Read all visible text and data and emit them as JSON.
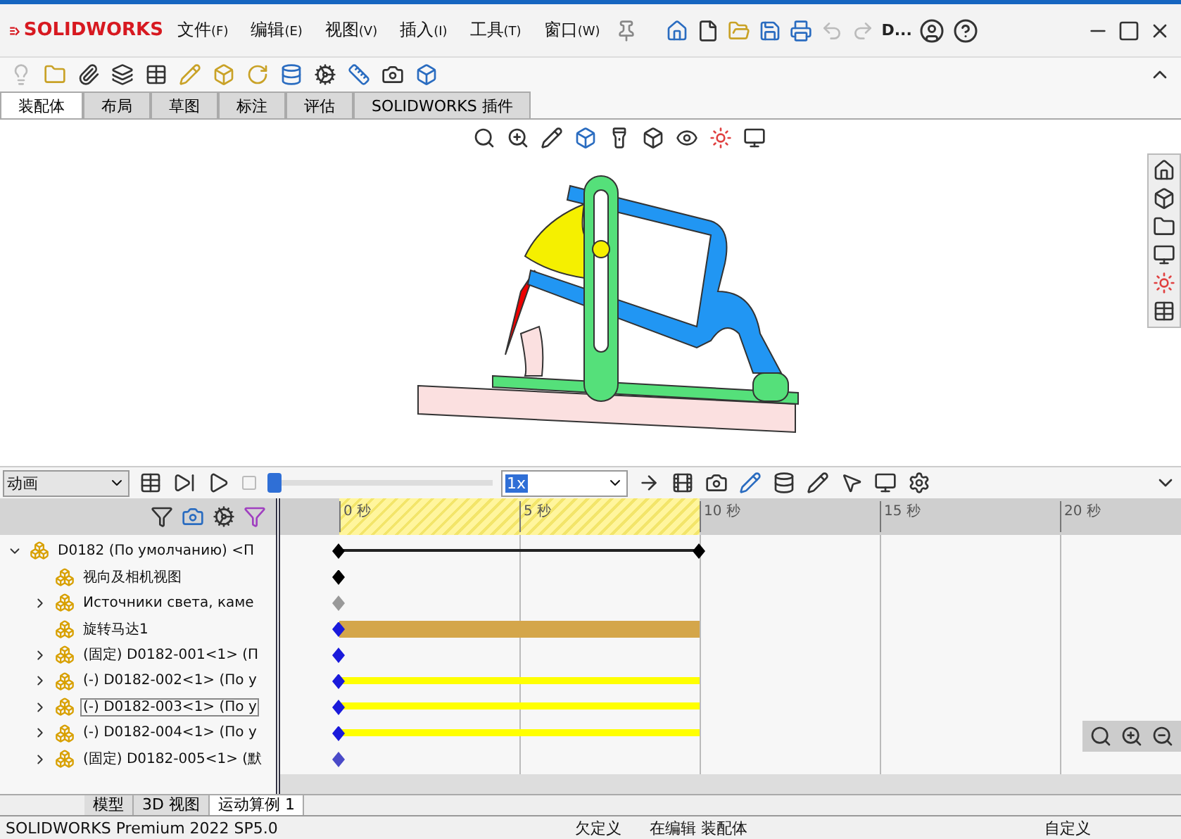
{
  "app": {
    "logo": "SOLIDWORKS",
    "document": "D..."
  },
  "menu": [
    {
      "label": "文件",
      "key": "(F)"
    },
    {
      "label": "编辑",
      "key": "(E)"
    },
    {
      "label": "视图",
      "key": "(V)"
    },
    {
      "label": "插入",
      "key": "(I)"
    },
    {
      "label": "工具",
      "key": "(T)"
    },
    {
      "label": "窗口",
      "key": "(W)"
    }
  ],
  "tabs": [
    {
      "label": "装配体",
      "selected": true
    },
    {
      "label": "布局",
      "selected": false
    },
    {
      "label": "草图",
      "selected": false
    },
    {
      "label": "标注",
      "selected": false
    },
    {
      "label": "评估",
      "selected": false
    },
    {
      "label": "SOLIDWORKS 插件",
      "selected": false
    }
  ],
  "motion": {
    "study_type": "动画",
    "speed": "1x",
    "playhead": {
      "level": 0.0
    }
  },
  "timeline": {
    "ticks": [
      "0 秒",
      "5 秒",
      "10 秒",
      "15 秒",
      "20 秒"
    ]
  },
  "tree": [
    {
      "label": "D0182 (По умолчанию) <П",
      "expanded": true,
      "selected": false,
      "kind": "span",
      "color": "#000000",
      "children": [
        {
          "label": "视向及相机视图",
          "selected": false,
          "kind": "none",
          "color": "#000000"
        },
        {
          "label": "Источники света, каме",
          "expanded": false,
          "selected": false,
          "kind": "none",
          "color": "#999999"
        },
        {
          "label": "旋转马达1",
          "selected": false,
          "kind": "motor",
          "color": "#1a1adb"
        },
        {
          "label": "(固定) D0182-001<1> (П",
          "expanded": false,
          "selected": false,
          "kind": "none",
          "color": "#1a1adb"
        },
        {
          "label": "(-) D0182-002<1> (По у",
          "expanded": false,
          "selected": false,
          "kind": "moving",
          "color": "#1a1adb"
        },
        {
          "label": "(-) D0182-003<1> (По у",
          "expanded": false,
          "selected": true,
          "kind": "moving",
          "color": "#1a1adb"
        },
        {
          "label": "(-) D0182-004<1> (По у",
          "expanded": false,
          "selected": false,
          "kind": "moving",
          "color": "#1a1adb"
        },
        {
          "label": "(固定) D0182-005<1> (默",
          "expanded": false,
          "selected": false,
          "kind": "none",
          "color": "#4a4ac8"
        }
      ]
    }
  ],
  "bottom_tabs": [
    {
      "label": "模型",
      "selected": false
    },
    {
      "label": "3D 视图",
      "selected": false
    },
    {
      "label": "运动算例 1",
      "selected": true
    }
  ],
  "status_bar": {
    "product": "SOLIDWORKS Premium 2022 SP5.0",
    "state": "欠定义",
    "mode": "在编辑 装配体",
    "units": "自定义"
  }
}
